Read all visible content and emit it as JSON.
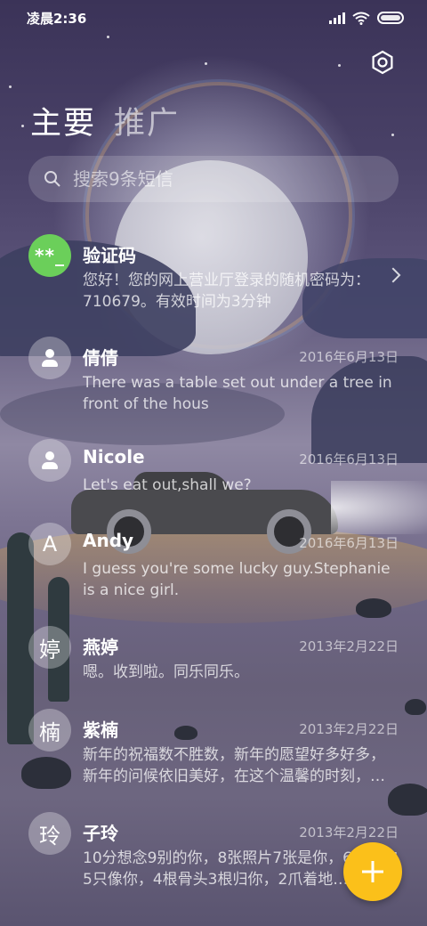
{
  "status_bar": {
    "time": "凌晨2:36"
  },
  "header": {
    "tabs": [
      {
        "label": "主要",
        "active": true
      },
      {
        "label": "推广",
        "active": false
      }
    ]
  },
  "search": {
    "placeholder": "搜索9条短信"
  },
  "messages": [
    {
      "name": "验证码",
      "avatar_text": "**_",
      "avatar_color": "#6bcf5a",
      "date": "",
      "preview": "您好！您的网上营业厅登录的随机密码为：710679。有效时间为3分钟",
      "has_chevron": true
    },
    {
      "name": "倩倩",
      "avatar_icon": "person-icon",
      "date": "2016年6月13日",
      "preview": "There was a table set out under a tree in front of the hous"
    },
    {
      "name": "Nicole",
      "avatar_icon": "person-icon",
      "date": "2016年6月13日",
      "preview": "Let's eat out,shall we?"
    },
    {
      "name": "Andy",
      "avatar_text": "A",
      "date": "2016年6月13日",
      "preview": "I guess you're some lucky guy.Stephanie is a nice girl."
    },
    {
      "name": "燕婷",
      "avatar_text": "婷",
      "date": "2013年2月22日",
      "preview": "嗯。收到啦。同乐同乐。"
    },
    {
      "name": "紫楠",
      "avatar_text": "楠",
      "date": "2013年2月22日",
      "preview": "新年的祝福数不胜数，新年的愿望好多好多，新年的问候依旧美好，在这个温馨的时刻，…"
    },
    {
      "name": "子玲",
      "avatar_text": "玲",
      "date": "2013年2月22日",
      "preview": "10分想念9别的你，8张照片7张是你，6只小狗5只像你，4根骨头3根归你，2爪着地…"
    }
  ],
  "colors": {
    "fab": "#fbc01a",
    "verify_avatar": "#6bcf5a"
  },
  "icons": {
    "settings": "gear-icon",
    "search": "search-icon",
    "compose": "plus-icon"
  }
}
